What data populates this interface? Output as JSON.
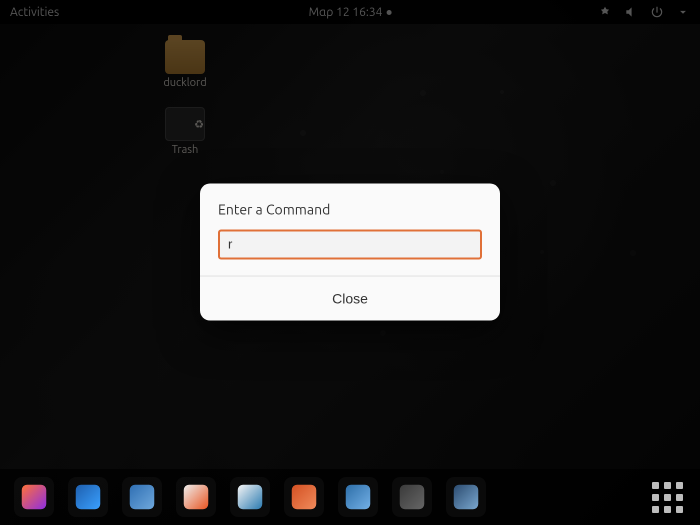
{
  "topbar": {
    "activities_label": "Activities",
    "clock": "Μαρ 12  16:34"
  },
  "desktop": {
    "folder_label": "ducklord",
    "trash_label": "Trash"
  },
  "dialog": {
    "title": "Enter a Command",
    "input_value": "r",
    "close_label": "Close"
  },
  "dock": {
    "items": [
      {
        "name": "firefox",
        "color_a": "#ff7139",
        "color_b": "#8e2de2"
      },
      {
        "name": "thunderbird",
        "color_a": "#1e5fae",
        "color_b": "#3aa0ff"
      },
      {
        "name": "files",
        "color_a": "#2f6fb3",
        "color_b": "#6fa8dc"
      },
      {
        "name": "rhythmbox",
        "color_a": "#eeeeee",
        "color_b": "#e95420"
      },
      {
        "name": "libreoffice-writer",
        "color_a": "#f5f5f5",
        "color_b": "#2a7ab0"
      },
      {
        "name": "software",
        "color_a": "#d35022",
        "color_b": "#f08b5c"
      },
      {
        "name": "help",
        "color_a": "#2d6ea8",
        "color_b": "#73b0e6"
      },
      {
        "name": "settings",
        "color_a": "#3a3a3a",
        "color_b": "#666"
      },
      {
        "name": "screenshot",
        "color_a": "#2b4b6f",
        "color_b": "#7aa7cf"
      }
    ]
  }
}
